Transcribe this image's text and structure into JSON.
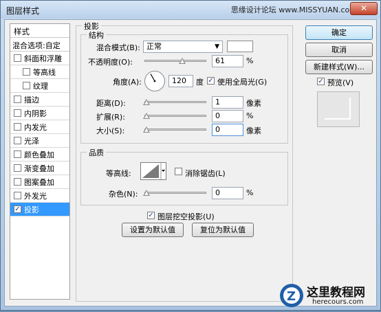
{
  "window": {
    "title": "图层样式",
    "watermark": "思缘设计论坛 www.MISSYUAN.com",
    "close_label": "✕"
  },
  "style_list": {
    "header": "样式",
    "blend_options": "混合选项:自定",
    "items": [
      {
        "label": "斜面和浮雕",
        "checked": false,
        "indent": false,
        "selected": false
      },
      {
        "label": "等高线",
        "checked": false,
        "indent": true,
        "selected": false
      },
      {
        "label": "纹理",
        "checked": false,
        "indent": true,
        "selected": false
      },
      {
        "label": "描边",
        "checked": false,
        "indent": false,
        "selected": false
      },
      {
        "label": "内阴影",
        "checked": false,
        "indent": false,
        "selected": false
      },
      {
        "label": "内发光",
        "checked": false,
        "indent": false,
        "selected": false
      },
      {
        "label": "光泽",
        "checked": false,
        "indent": false,
        "selected": false
      },
      {
        "label": "颜色叠加",
        "checked": false,
        "indent": false,
        "selected": false
      },
      {
        "label": "渐变叠加",
        "checked": false,
        "indent": false,
        "selected": false
      },
      {
        "label": "图案叠加",
        "checked": false,
        "indent": false,
        "selected": false
      },
      {
        "label": "外发光",
        "checked": false,
        "indent": false,
        "selected": false
      },
      {
        "label": "投影",
        "checked": true,
        "indent": false,
        "selected": true
      }
    ]
  },
  "drop_shadow": {
    "title": "投影",
    "structure": {
      "title": "结构",
      "blend_mode_label": "混合模式(B):",
      "blend_mode_value": "正常",
      "shadow_color": "#ffffff",
      "opacity_label": "不透明度(O):",
      "opacity_value": "61",
      "opacity_unit": "%",
      "opacity_fraction": 0.61,
      "angle_label": "角度(A):",
      "angle_value": "120",
      "angle_unit": "度",
      "global_light_label": "使用全局光(G)",
      "global_light_checked": true,
      "distance_label": "距离(D):",
      "distance_value": "1",
      "distance_unit": "像素",
      "spread_label": "扩展(R):",
      "spread_value": "0",
      "spread_unit": "%",
      "size_label": "大小(S):",
      "size_value": "0",
      "size_unit": "像素"
    },
    "quality": {
      "title": "品质",
      "contour_label": "等高线:",
      "anti_alias_label": "消除锯齿(L)",
      "anti_alias_checked": false,
      "noise_label": "杂色(N):",
      "noise_value": "0",
      "noise_unit": "%"
    },
    "knockout_label": "图层挖空投影(U)",
    "knockout_checked": true,
    "make_default": "设置为默认值",
    "reset_default": "复位为默认值"
  },
  "buttons": {
    "ok": "确定",
    "cancel": "取消",
    "new_style": "新建样式(W)...",
    "preview_label": "预览(V)",
    "preview_checked": true
  },
  "logo": {
    "name": "这里教程网",
    "url": "herecours.com"
  }
}
